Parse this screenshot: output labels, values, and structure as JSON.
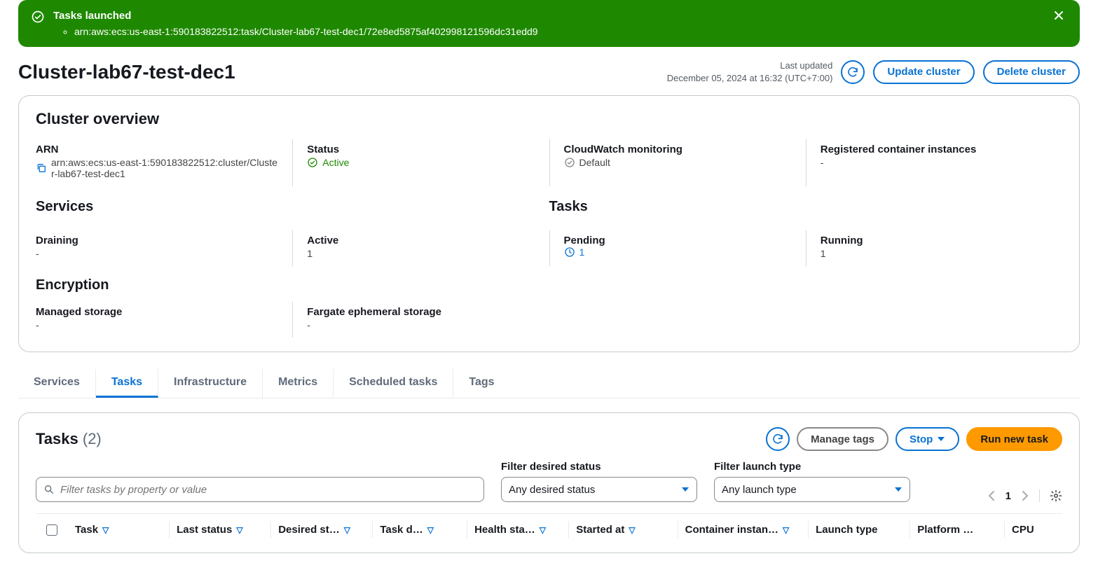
{
  "notification": {
    "title": "Tasks launched",
    "item": "arn:aws:ecs:us-east-1:590183822512:task/Cluster-lab67-test-dec1/72e8ed5875af402998121596dc31edd9"
  },
  "header": {
    "cluster_name": "Cluster-lab67-test-dec1",
    "last_updated_label": "Last updated",
    "last_updated_value": "December 05, 2024 at 16:32 (UTC+7:00)",
    "update_button": "Update cluster",
    "delete_button": "Delete cluster"
  },
  "overview": {
    "title": "Cluster overview",
    "arn": {
      "label": "ARN",
      "value": "arn:aws:ecs:us-east-1:590183822512:cluster/Cluster-lab67-test-dec1"
    },
    "status": {
      "label": "Status",
      "value": "Active"
    },
    "cw": {
      "label": "CloudWatch monitoring",
      "value": "Default"
    },
    "rci": {
      "label": "Registered container instances",
      "value": "-"
    },
    "services_title": "Services",
    "tasks_title": "Tasks",
    "draining": {
      "label": "Draining",
      "value": "-"
    },
    "active": {
      "label": "Active",
      "value": "1"
    },
    "pending": {
      "label": "Pending",
      "value": "1"
    },
    "running": {
      "label": "Running",
      "value": "1"
    },
    "encryption_title": "Encryption",
    "managed": {
      "label": "Managed storage",
      "value": "-"
    },
    "fargate": {
      "label": "Fargate ephemeral storage",
      "value": "-"
    }
  },
  "tabs": {
    "services": "Services",
    "tasks": "Tasks",
    "infra": "Infrastructure",
    "metrics": "Metrics",
    "scheduled": "Scheduled tasks",
    "tags": "Tags"
  },
  "tasks_panel": {
    "title": "Tasks",
    "count": "(2)",
    "manage_tags": "Manage tags",
    "stop": "Stop",
    "run_new": "Run new task",
    "search_placeholder": "Filter tasks by property or value",
    "fds_label": "Filter desired status",
    "fds_value": "Any desired status",
    "flt_label": "Filter launch type",
    "flt_value": "Any launch type",
    "page": "1",
    "columns": {
      "task": "Task",
      "last_status": "Last status",
      "desired": "Desired st…",
      "taskd": "Task d…",
      "health": "Health sta…",
      "started": "Started at",
      "cinst": "Container instan…",
      "launch": "Launch type",
      "platform": "Platform …",
      "cpu": "CPU"
    }
  }
}
